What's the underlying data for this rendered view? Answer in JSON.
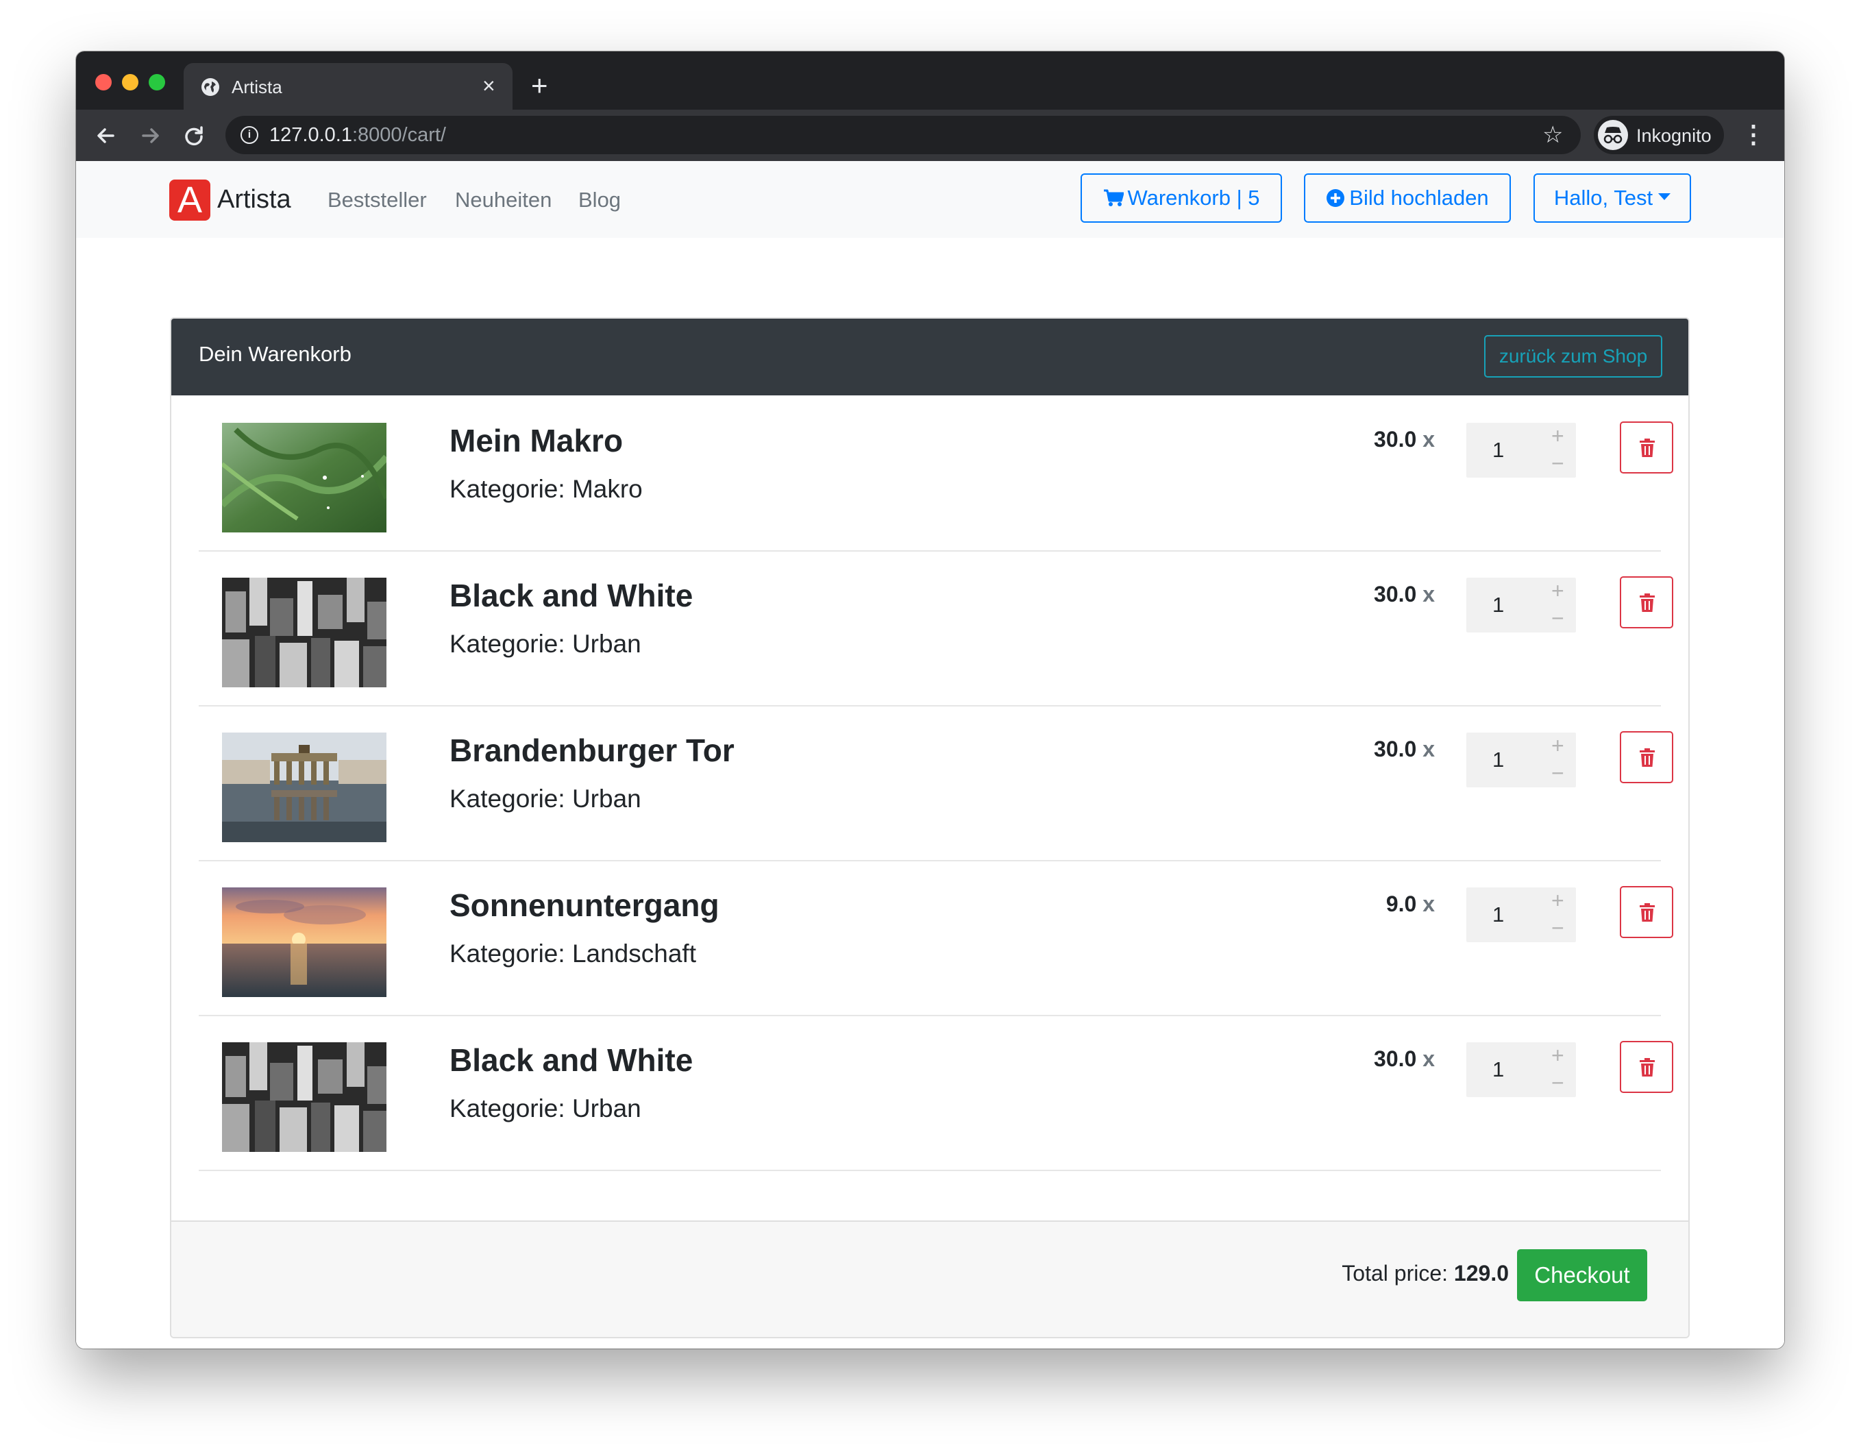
{
  "browser": {
    "tab_title": "Artista",
    "tab_close": "×",
    "new_tab": "+",
    "url_host": "127.0.0.1",
    "url_rest": ":8000/cart/",
    "profile_label": "Inkognito"
  },
  "navbar": {
    "brand_letter": "A",
    "brand_name": "Artista",
    "links": [
      "Beststeller",
      "Neuheiten",
      "Blog"
    ],
    "cart_button": "Warenkorb | 5",
    "upload_button": "Bild hochladen",
    "user_button": "Hallo, Test"
  },
  "cart": {
    "title": "Dein Warenkorb",
    "back_button": "zurück zum Shop",
    "items": [
      {
        "name": "Mein Makro",
        "category": "Kategorie: Makro",
        "price": "30.0",
        "times": "x",
        "qty": "1",
        "image": "green-macro-photo"
      },
      {
        "name": "Black and White",
        "category": "Kategorie: Urban",
        "price": "30.0",
        "times": "x",
        "qty": "1",
        "image": "bw-city-photo"
      },
      {
        "name": "Brandenburger Tor",
        "category": "Kategorie: Urban",
        "price": "30.0",
        "times": "x",
        "qty": "1",
        "image": "brandenburg-gate-photo"
      },
      {
        "name": "Sonnenuntergang",
        "category": "Kategorie: Landschaft",
        "price": "9.0",
        "times": "x",
        "qty": "1",
        "image": "sunset-photo"
      },
      {
        "name": "Black and White",
        "category": "Kategorie: Urban",
        "price": "30.0",
        "times": "x",
        "qty": "1",
        "image": "bw-city-photo"
      }
    ],
    "qty_plus": "+",
    "qty_minus": "−",
    "total_label": "Total price:",
    "total_value": "129.0",
    "checkout_button": "Checkout"
  },
  "colors": {
    "primary": "#007bff",
    "info": "#17a2b8",
    "danger": "#dc3545",
    "success": "#28a745",
    "dark": "#343a40",
    "brand": "#e52d27"
  }
}
